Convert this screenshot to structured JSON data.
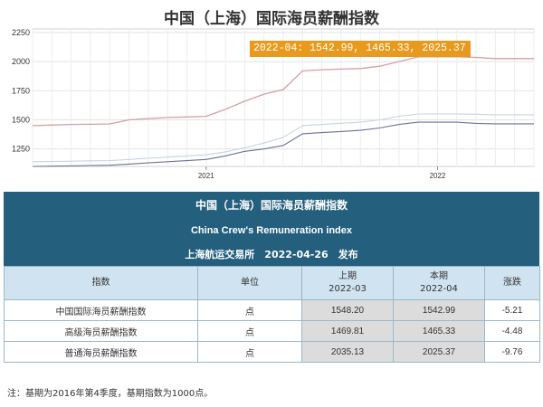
{
  "chart": {
    "title": "中国（上海）国际海员薪酬指数",
    "tooltip": "2022-04: 1542.99, 1465.33, 2025.37"
  },
  "chart_data": {
    "type": "line",
    "title": "中国（上海）国际海员薪酬指数",
    "xlabel": "",
    "ylabel": "",
    "x_ticks": [
      "2021",
      "2022"
    ],
    "y_ticks": [
      1250,
      1500,
      1750,
      2000,
      2250
    ],
    "ylim": [
      1100,
      2280
    ],
    "grid": true,
    "x": [
      "2020-04",
      "2020-05",
      "2020-06",
      "2020-07",
      "2020-08",
      "2020-09",
      "2020-10",
      "2020-11",
      "2020-12",
      "2021-01",
      "2021-02",
      "2021-03",
      "2021-04",
      "2021-05",
      "2021-06",
      "2021-07",
      "2021-08",
      "2021-09",
      "2021-10",
      "2021-11",
      "2021-12",
      "2022-01",
      "2022-02",
      "2022-03",
      "2022-04"
    ],
    "series": [
      {
        "color": "#d59ea4",
        "values": [
          1450,
          1455,
          1460,
          1462,
          1465,
          1500,
          1510,
          1520,
          1525,
          1530,
          1590,
          1660,
          1720,
          1760,
          1920,
          1930,
          1935,
          1940,
          1960,
          2000,
          2040,
          2040,
          2040,
          2035.13,
          2025.37
        ]
      },
      {
        "color": "#c6d4e0",
        "values": [
          1140,
          1142,
          1145,
          1148,
          1150,
          1160,
          1170,
          1180,
          1190,
          1200,
          1225,
          1260,
          1300,
          1350,
          1450,
          1460,
          1470,
          1480,
          1500,
          1530,
          1550,
          1550,
          1550,
          1548.2,
          1542.99
        ]
      },
      {
        "color": "#6b7296",
        "values": [
          1100,
          1102,
          1105,
          1108,
          1110,
          1120,
          1130,
          1140,
          1150,
          1160,
          1190,
          1230,
          1250,
          1280,
          1380,
          1390,
          1400,
          1410,
          1430,
          1460,
          1480,
          1480,
          1480,
          1469.81,
          1465.33
        ]
      }
    ]
  },
  "table": {
    "header_cn": "中国（上海）国际海员薪酬指数",
    "header_en": "China Crew's Remuneration index",
    "header_pub": "上海航运交易所　2022-04-26　发布",
    "columns": {
      "index": "指数",
      "unit": "单位",
      "prev": "上期",
      "prev_period": "2022-03",
      "cur": "本期",
      "cur_period": "2022-04",
      "change": "涨跌"
    },
    "rows": [
      {
        "name": "中国国际海员薪酬指数",
        "unit": "点",
        "prev": "1548.20",
        "cur": "1542.99",
        "change": "-5.21"
      },
      {
        "name": "高级海员薪酬指数",
        "unit": "点",
        "prev": "1469.81",
        "cur": "1465.33",
        "change": "-4.48"
      },
      {
        "name": "普通海员薪酬指数",
        "unit": "点",
        "prev": "2035.13",
        "cur": "2025.37",
        "change": "-9.76"
      }
    ]
  },
  "footer": {
    "note": "注：基期为2016年第4季度，基期指数为1000点。"
  }
}
